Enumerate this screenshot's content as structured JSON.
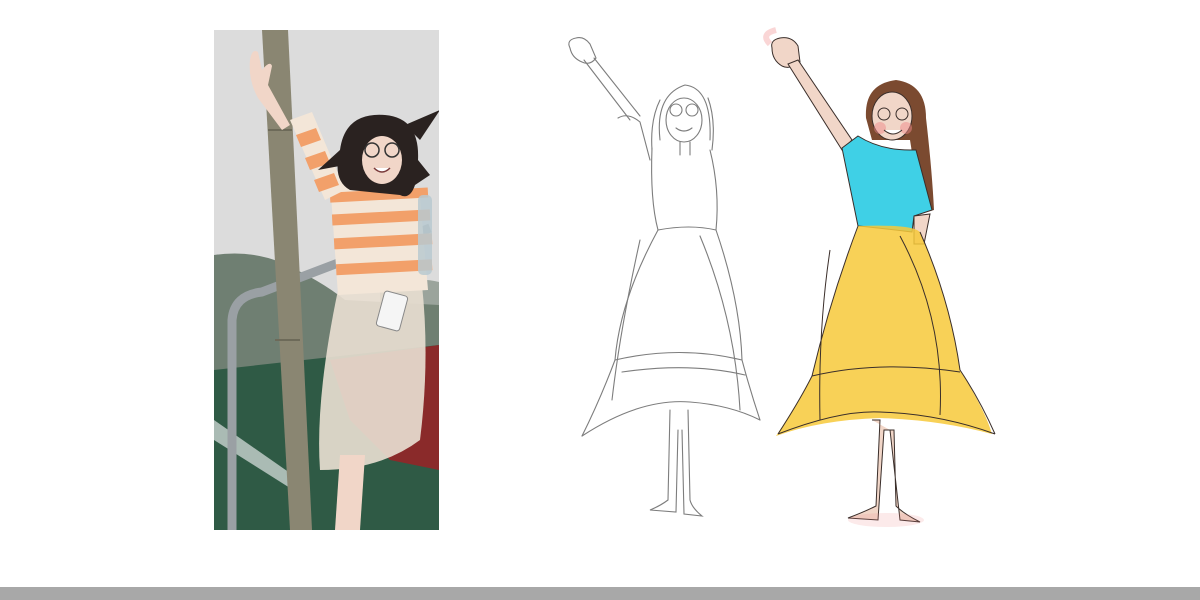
{
  "panels": [
    {
      "id": "photo",
      "kind": "photograph"
    },
    {
      "id": "pencil-sketch",
      "kind": "line-drawing"
    },
    {
      "id": "colored-illustration",
      "kind": "watercolor-drawing"
    }
  ],
  "colors": {
    "background": "#ffffff",
    "footer_bar": "#a8a8a8",
    "sky": "#dcdcdc",
    "mountain": "#6f7f72",
    "boat_green": "#2f5a45",
    "boat_red": "#8a2a2a",
    "pole": "#8a8672",
    "railing": "#9aa0a4",
    "stripe_orange": "#f2a06a",
    "stripe_cream": "#f3e6d8",
    "skirt_photo": "#e7ddd0",
    "skin": "#f1d6c8",
    "hair": "#2a2220",
    "pencil": "#7d7d7d",
    "ink": "#3a2e2a",
    "top_cyan": "#3fd0e6",
    "skirt_yellow": "#f7c93a",
    "hair_brown": "#7b4a30",
    "blush": "#f08a8a"
  },
  "icons": [
    "waving-hand-icon"
  ]
}
